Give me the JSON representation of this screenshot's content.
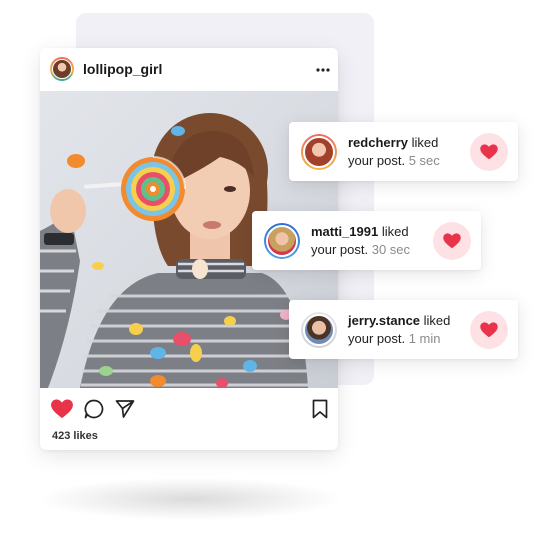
{
  "post": {
    "username": "lollipop_girl",
    "likes_text": "423 likes",
    "liked": true
  },
  "notifications": [
    {
      "user": "redcherry",
      "action": "liked",
      "message": "your post.",
      "time": "5 sec"
    },
    {
      "user": "matti_1991",
      "action": "liked",
      "message": "your post.",
      "time": "30 sec"
    },
    {
      "user": "jerry.stance",
      "action": "liked",
      "message": "your post.",
      "time": "1 min"
    }
  ],
  "icons": {
    "menu": "more-horizontal-icon",
    "like": "heart-icon",
    "comment": "comment-icon",
    "share": "send-icon",
    "save": "bookmark-icon"
  },
  "colors": {
    "like_red": "#e8334a",
    "heart_bg": "#fde1e5",
    "card_back": "#f1f0f6",
    "time_gray": "#8a8a8a"
  }
}
